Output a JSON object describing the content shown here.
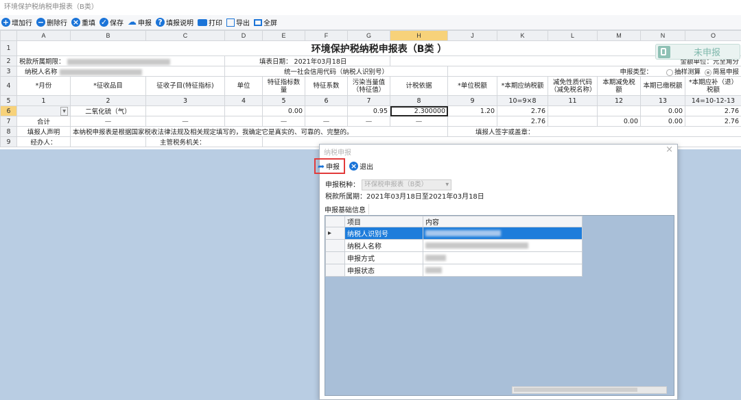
{
  "window": {
    "title": "环境保护税纳税申报表（B类）"
  },
  "toolbar": {
    "add_row": "增加行",
    "delete_row": "删除行",
    "refill": "重填",
    "save": "保存",
    "declare": "申报",
    "help": "填报说明",
    "print": "打印",
    "export": "导出",
    "fullscreen": "全屏"
  },
  "sheet": {
    "columns": [
      "A",
      "B",
      "C",
      "D",
      "E",
      "F",
      "G",
      "H",
      "J",
      "K",
      "L",
      "M",
      "N",
      "O"
    ],
    "row_numbers": [
      "1",
      "2",
      "3",
      "4",
      "5",
      "6",
      "7",
      "8",
      "9"
    ],
    "title": "环境保护税纳税申报表（B类 ）",
    "status_badge": "未申报",
    "period_label": "税款所属期限：",
    "fill_date": "填表日期： 2021年03月18日",
    "amount_unit": "金额单位：元至角分",
    "taxpayer_name_label": "纳税人名称",
    "credit_code_label": "统一社会信用代码（纳税人识别号）",
    "declare_type_label": "申报类型：",
    "declare_type_options": [
      "抽样测算",
      "简易申报"
    ],
    "headers": [
      "*月份",
      "*征收品目",
      "征收子目(特征指标)",
      "单位",
      "特征指标数量",
      "特征系数",
      "污染当量值（特征值）",
      "计税依据",
      "*单位税额",
      "*本期应纳税额",
      "减免性质代码（减免税名称）",
      "本期减免税额",
      "本期已缴税额",
      "*本期应补（退）税额"
    ],
    "index_row": [
      "1",
      "2",
      "3",
      "4",
      "5",
      "6",
      "7",
      "8",
      "9",
      "10=9×8",
      "11",
      "12",
      "13",
      "14=10-12-13"
    ],
    "data_row": {
      "item": "二氧化硫（气）",
      "qty": "0.00",
      "pollutant": "0.95",
      "basis": "2.300000",
      "unit_tax": "1.20",
      "payable": "2.76",
      "paid": "0.00",
      "balance": "2.76"
    },
    "total_row": {
      "label": "合计",
      "dash": "—",
      "payable": "2.76",
      "reduced": "0.00",
      "paid": "0.00",
      "balance": "2.76"
    },
    "statement_label": "填报人声明",
    "statement_text": "本纳税申报表是根据国家税收法律法规及相关规定填写的，我确定它是真实的、可靠的、完整的。",
    "sign_label": "填报人签字或盖章：",
    "handler_label": "经办人：",
    "authority_label": "主管税务机关："
  },
  "dialog": {
    "title": "纳税申报",
    "declare_label": "申报",
    "exit_label": "退出",
    "tax_type_label": "申报税种：",
    "tax_type_value": "环保税申报表（B类）",
    "period_text": "税款所属期：2021年03月18日至2021年03月18日",
    "tab_label": "申报基础信息",
    "table_headers": [
      "项目",
      "内容"
    ],
    "table_rows": [
      "纳税人识别号",
      "纳税人名称",
      "申报方式",
      "申报状态"
    ]
  },
  "colors": {
    "accent": "#1b74d8",
    "highlight": "#e23a3a",
    "selection": "#1e7ddb"
  }
}
